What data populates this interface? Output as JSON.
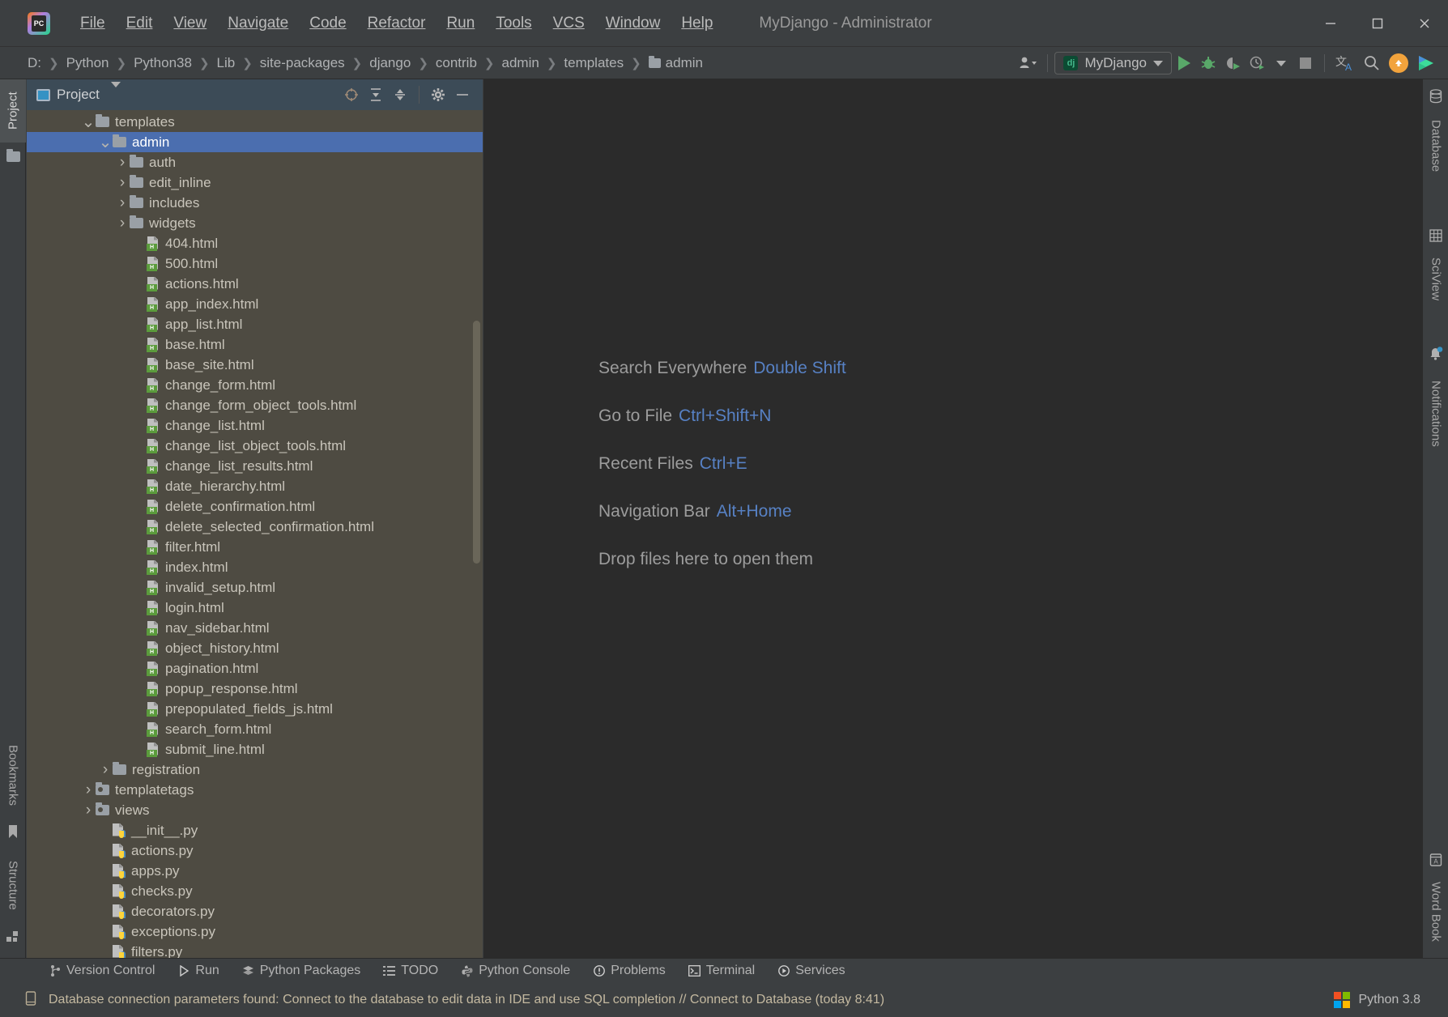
{
  "titlebar": {
    "app_icon": "pycharm-logo",
    "logo_text": "PC",
    "menus": [
      "File",
      "Edit",
      "View",
      "Navigate",
      "Code",
      "Refactor",
      "Run",
      "Tools",
      "VCS",
      "Window",
      "Help"
    ],
    "window_title": "MyDjango - Administrator",
    "controls": [
      "minimize-icon",
      "maximize-icon",
      "close-icon"
    ]
  },
  "navbar": {
    "breadcrumbs": [
      "D:",
      "Python",
      "Python38",
      "Lib",
      "site-packages",
      "django",
      "contrib",
      "admin",
      "templates",
      "admin"
    ],
    "current_folder": "admin",
    "run_config": "MyDjango",
    "run_config_badge": "dj",
    "actions": [
      "user-menu-icon",
      "run-icon",
      "debug-icon",
      "run-coverage-icon",
      "profile-icon",
      "stop-icon",
      "translate-icon",
      "search-icon",
      "update-icon",
      "run-multiple-icon"
    ]
  },
  "left_strip": {
    "top_tabs": [
      {
        "label": "Project",
        "active": true
      }
    ],
    "bottom_tabs": [
      {
        "label": "Bookmarks",
        "active": false
      },
      {
        "label": "Structure",
        "active": false
      }
    ]
  },
  "right_strip": {
    "top_tabs": [
      {
        "label": "Database",
        "icon": "database-icon"
      },
      {
        "label": "SciView",
        "icon": "grid-icon"
      },
      {
        "label": "Notifications",
        "icon": "bell-icon"
      }
    ],
    "bottom_tabs": [
      {
        "label": "Word Book",
        "icon": "book-icon"
      }
    ]
  },
  "project_panel": {
    "title": "Project",
    "header_actions": [
      "select-opened-file-icon",
      "expand-all-icon",
      "collapse-all-icon",
      "settings-gear-icon",
      "hide-icon"
    ],
    "tree": [
      {
        "label": "templates",
        "type": "folder",
        "indent": 3,
        "state": "expanded",
        "selected": false
      },
      {
        "label": "admin",
        "type": "folder",
        "indent": 4,
        "state": "expanded",
        "selected": true
      },
      {
        "label": "auth",
        "type": "folder",
        "indent": 5,
        "state": "collapsed",
        "selected": false
      },
      {
        "label": "edit_inline",
        "type": "folder",
        "indent": 5,
        "state": "collapsed",
        "selected": false
      },
      {
        "label": "includes",
        "type": "folder",
        "indent": 5,
        "state": "collapsed",
        "selected": false
      },
      {
        "label": "widgets",
        "type": "folder",
        "indent": 5,
        "state": "collapsed",
        "selected": false
      },
      {
        "label": "404.html",
        "type": "html",
        "indent": 6,
        "state": "leaf",
        "selected": false
      },
      {
        "label": "500.html",
        "type": "html",
        "indent": 6,
        "state": "leaf",
        "selected": false
      },
      {
        "label": "actions.html",
        "type": "html",
        "indent": 6,
        "state": "leaf",
        "selected": false
      },
      {
        "label": "app_index.html",
        "type": "html",
        "indent": 6,
        "state": "leaf",
        "selected": false
      },
      {
        "label": "app_list.html",
        "type": "html",
        "indent": 6,
        "state": "leaf",
        "selected": false
      },
      {
        "label": "base.html",
        "type": "html",
        "indent": 6,
        "state": "leaf",
        "selected": false
      },
      {
        "label": "base_site.html",
        "type": "html",
        "indent": 6,
        "state": "leaf",
        "selected": false
      },
      {
        "label": "change_form.html",
        "type": "html",
        "indent": 6,
        "state": "leaf",
        "selected": false
      },
      {
        "label": "change_form_object_tools.html",
        "type": "html",
        "indent": 6,
        "state": "leaf",
        "selected": false
      },
      {
        "label": "change_list.html",
        "type": "html",
        "indent": 6,
        "state": "leaf",
        "selected": false
      },
      {
        "label": "change_list_object_tools.html",
        "type": "html",
        "indent": 6,
        "state": "leaf",
        "selected": false
      },
      {
        "label": "change_list_results.html",
        "type": "html",
        "indent": 6,
        "state": "leaf",
        "selected": false
      },
      {
        "label": "date_hierarchy.html",
        "type": "html",
        "indent": 6,
        "state": "leaf",
        "selected": false
      },
      {
        "label": "delete_confirmation.html",
        "type": "html",
        "indent": 6,
        "state": "leaf",
        "selected": false
      },
      {
        "label": "delete_selected_confirmation.html",
        "type": "html",
        "indent": 6,
        "state": "leaf",
        "selected": false
      },
      {
        "label": "filter.html",
        "type": "html",
        "indent": 6,
        "state": "leaf",
        "selected": false
      },
      {
        "label": "index.html",
        "type": "html",
        "indent": 6,
        "state": "leaf",
        "selected": false
      },
      {
        "label": "invalid_setup.html",
        "type": "html",
        "indent": 6,
        "state": "leaf",
        "selected": false
      },
      {
        "label": "login.html",
        "type": "html",
        "indent": 6,
        "state": "leaf",
        "selected": false
      },
      {
        "label": "nav_sidebar.html",
        "type": "html",
        "indent": 6,
        "state": "leaf",
        "selected": false
      },
      {
        "label": "object_history.html",
        "type": "html",
        "indent": 6,
        "state": "leaf",
        "selected": false
      },
      {
        "label": "pagination.html",
        "type": "html",
        "indent": 6,
        "state": "leaf",
        "selected": false
      },
      {
        "label": "popup_response.html",
        "type": "html",
        "indent": 6,
        "state": "leaf",
        "selected": false
      },
      {
        "label": "prepopulated_fields_js.html",
        "type": "html",
        "indent": 6,
        "state": "leaf",
        "selected": false
      },
      {
        "label": "search_form.html",
        "type": "html",
        "indent": 6,
        "state": "leaf",
        "selected": false
      },
      {
        "label": "submit_line.html",
        "type": "html",
        "indent": 6,
        "state": "leaf",
        "selected": false
      },
      {
        "label": "registration",
        "type": "folder",
        "indent": 4,
        "state": "collapsed",
        "selected": false
      },
      {
        "label": "templatetags",
        "type": "package",
        "indent": 3,
        "state": "collapsed",
        "selected": false
      },
      {
        "label": "views",
        "type": "package",
        "indent": 3,
        "state": "collapsed",
        "selected": false
      },
      {
        "label": "__init__.py",
        "type": "py",
        "indent": 4,
        "state": "leaf",
        "selected": false
      },
      {
        "label": "actions.py",
        "type": "py",
        "indent": 4,
        "state": "leaf",
        "selected": false
      },
      {
        "label": "apps.py",
        "type": "py",
        "indent": 4,
        "state": "leaf",
        "selected": false
      },
      {
        "label": "checks.py",
        "type": "py",
        "indent": 4,
        "state": "leaf",
        "selected": false
      },
      {
        "label": "decorators.py",
        "type": "py",
        "indent": 4,
        "state": "leaf",
        "selected": false
      },
      {
        "label": "exceptions.py",
        "type": "py",
        "indent": 4,
        "state": "leaf",
        "selected": false
      },
      {
        "label": "filters.py",
        "type": "py",
        "indent": 4,
        "state": "leaf",
        "selected": false
      }
    ]
  },
  "editor": {
    "hints": [
      {
        "action": "Search Everywhere",
        "shortcut": "Double Shift"
      },
      {
        "action": "Go to File",
        "shortcut": "Ctrl+Shift+N"
      },
      {
        "action": "Recent Files",
        "shortcut": "Ctrl+E"
      },
      {
        "action": "Navigation Bar",
        "shortcut": "Alt+Home"
      },
      {
        "action": "Drop files here to open them",
        "shortcut": ""
      }
    ]
  },
  "bottom_bar": {
    "items": [
      {
        "label": "Version Control",
        "icon": "branch-icon"
      },
      {
        "label": "Run",
        "icon": "run-icon"
      },
      {
        "label": "Python Packages",
        "icon": "packages-icon"
      },
      {
        "label": "TODO",
        "icon": "list-icon"
      },
      {
        "label": "Python Console",
        "icon": "python-icon"
      },
      {
        "label": "Problems",
        "icon": "warning-icon"
      },
      {
        "label": "Terminal",
        "icon": "terminal-icon"
      },
      {
        "label": "Services",
        "icon": "services-icon"
      }
    ]
  },
  "status_bar": {
    "icon": "database-hint-icon",
    "message": "Database connection parameters found: Connect to the database to edit data in IDE and use SQL completion // Connect to Database (today 8:41)",
    "interpreter": "Python 3.8",
    "interpreter_icon": "windows-logo-icon"
  },
  "colors": {
    "accent_blue": "#4b6eaf",
    "editor_bg": "#2b2b2b",
    "panel_bg": "#4e4b42",
    "chrome_bg": "#3c3f41",
    "link_blue": "#5781c4",
    "green_run": "#59a869",
    "orange": "#f2a33c"
  }
}
